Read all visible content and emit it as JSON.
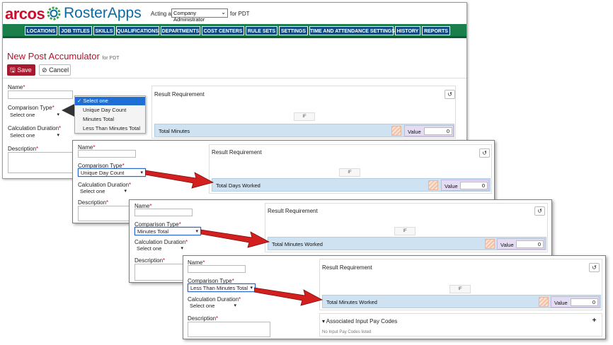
{
  "header": {
    "logo_brand": "arcos",
    "logo_product": "RosterApps",
    "acting_as_label": "Acting as",
    "role_value": "Company Administrator",
    "for_label": "for PDT"
  },
  "nav": {
    "tabs": [
      {
        "label": "LOCATIONS"
      },
      {
        "label": "JOB TITLES"
      },
      {
        "label": "SKILLS"
      },
      {
        "label": "QUALIFICATIONS"
      },
      {
        "label": "DEPARTMENTS"
      },
      {
        "label": "COST CENTERS"
      },
      {
        "label": "RULE SETS"
      },
      {
        "label": "SETTINGS"
      },
      {
        "label": "TIME AND ATTENDANCE SETTINGS"
      },
      {
        "label": "HISTORY"
      },
      {
        "label": "REPORTS"
      }
    ]
  },
  "page": {
    "title": "New Post Accumulator",
    "subtitle": "for PDT",
    "save_label": "Save",
    "cancel_label": "Cancel"
  },
  "form": {
    "name_label": "Name",
    "comparison_type_label": "Comparison Type",
    "calculation_duration_label": "Calculation Duration",
    "description_label": "Description",
    "required_mark": "*",
    "select_one": "Select one"
  },
  "dropdown": {
    "options": [
      "Select one",
      "Unique Day Count",
      "Minutes Total",
      "Less Than Minutes Total"
    ],
    "selected_index": 0,
    "check_mark": "✓"
  },
  "result": {
    "title": "Result Requirement",
    "if_label": "IF",
    "value_label": "Value",
    "undo_icon": "undo-icon"
  },
  "panels": [
    {
      "comparison_value": "Select one",
      "condition": "Total Minutes",
      "value": "0"
    },
    {
      "comparison_value": "Unique Day Count",
      "condition": "Total Days Worked",
      "value": "0"
    },
    {
      "comparison_value": "Minutes Total",
      "condition": "Total Minutes Worked",
      "value": "0"
    },
    {
      "comparison_value": "Less Than Minutes Total",
      "condition": "Total Minutes Worked",
      "value": "0"
    }
  ],
  "associated": {
    "title": "Associated Input Pay Codes",
    "empty_text": "No Input Pay Codes listed",
    "add_label": "+",
    "caret": "▾"
  },
  "colors": {
    "brand_red": "#c8102e",
    "nav_green": "#1a7f4b",
    "nav_tab_blue": "#114b84",
    "arrow_red": "#d41f1f",
    "condition_blue": "#cfe2f1"
  }
}
